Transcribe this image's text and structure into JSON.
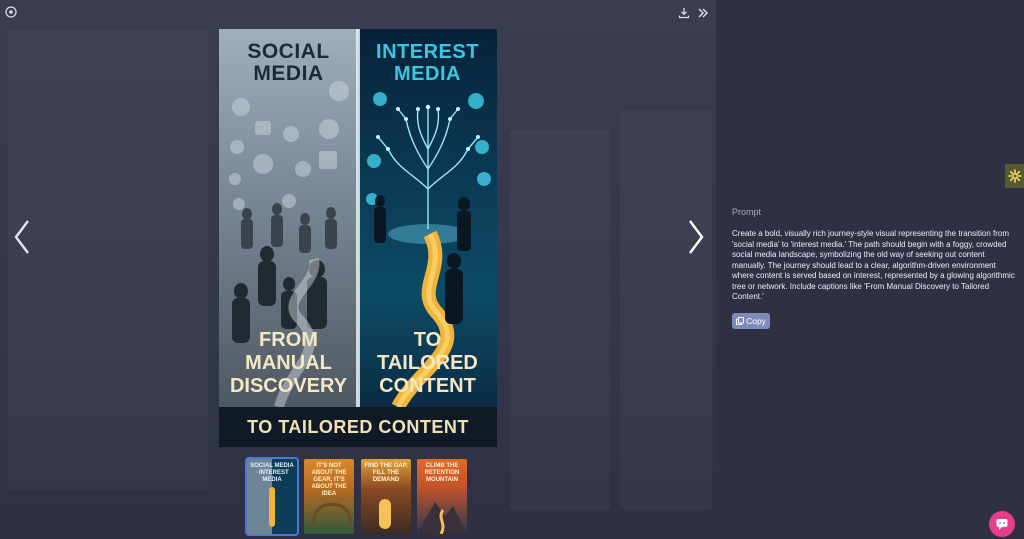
{
  "viewer": {
    "poster": {
      "left_title": [
        "SOCIAL",
        "MEDIA"
      ],
      "right_title": [
        "INTEREST",
        "MEDIA"
      ],
      "left_caption": [
        "FROM",
        "MANUAL",
        "DISCOVERY"
      ],
      "right_caption": [
        "TO",
        "TAILORED",
        "CONTENT"
      ],
      "banner": "TO TAILORED CONTENT"
    },
    "thumbnails": [
      {
        "title": "SOCIAL MEDIA · INTEREST MEDIA",
        "selected": true,
        "colors": [
          "#6e8595",
          "#0d3d58"
        ]
      },
      {
        "title": "IT'S NOT ABOUT THE GEAR, IT'S ABOUT THE IDEA",
        "selected": false,
        "colors": [
          "#d88a2a",
          "#2f5a3a"
        ]
      },
      {
        "title": "FIND THE GAP. FILL THE DEMAND",
        "selected": false,
        "colors": [
          "#e0a13a",
          "#3b2b22"
        ]
      },
      {
        "title": "CLIMB THE RETENTION MOUNTAIN",
        "selected": false,
        "colors": [
          "#e06a2a",
          "#2a3850"
        ]
      }
    ]
  },
  "panel": {
    "prompt_label": "Prompt",
    "prompt_text": "Create a bold, visually rich journey-style visual representing the transition from 'social media' to 'interest media.' The path should begin with a foggy, crowded social media landscape, symbolizing the old way of seeking out content manually. The journey should lead to a clear, algorithm-driven environment where content is served based on interest, represented by a glowing algorithmic tree or network. Include captions like 'From Manual Discovery to Tailored Content.'",
    "copy_label": "Copy"
  },
  "colors": {
    "accent": "#7e8ab8",
    "chat": "#e63e8c",
    "poster_right_title": "#3ec6e0",
    "poster_left_title": "#1d2a38"
  },
  "icons": [
    "back-circle-icon",
    "download-icon",
    "double-chevron-right-icon",
    "chevron-left-icon",
    "chevron-right-icon",
    "copy-icon",
    "sparkle-icon",
    "chat-icon"
  ]
}
